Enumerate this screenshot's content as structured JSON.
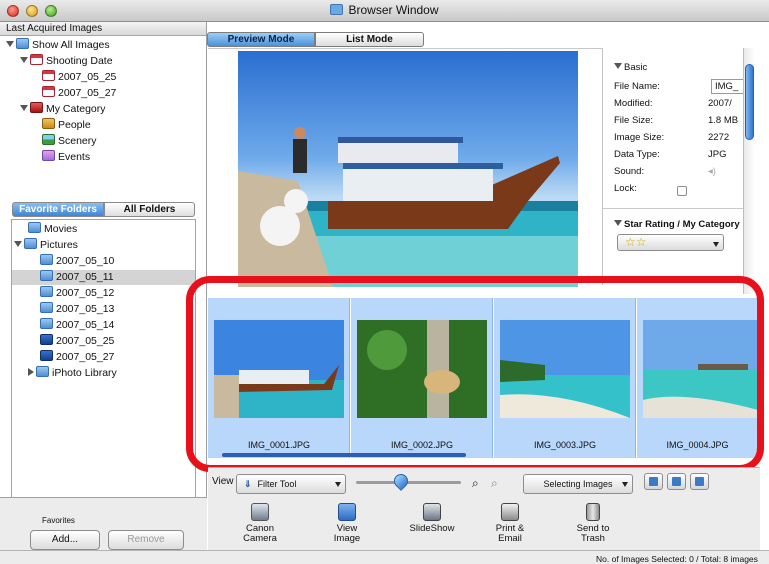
{
  "window": {
    "title": "Browser Window"
  },
  "sidebar": {
    "last_acquired_header": "Last Acquired Images",
    "tree": [
      {
        "label": "Show All Images",
        "icon": "all-images-icon"
      },
      {
        "label": "Shooting Date",
        "icon": "calendar-icon"
      },
      {
        "label": "2007_05_25",
        "icon": "calendar-date-icon"
      },
      {
        "label": "2007_05_27",
        "icon": "calendar-date-icon"
      },
      {
        "label": "My Category",
        "icon": "category-icon"
      },
      {
        "label": "People",
        "icon": "people-icon"
      },
      {
        "label": "Scenery",
        "icon": "scenery-icon"
      },
      {
        "label": "Events",
        "icon": "events-icon"
      }
    ],
    "tabs": [
      "Favorite Folders",
      "All Folders"
    ],
    "folders": [
      {
        "label": "Movies",
        "icon": "folder-icon"
      },
      {
        "label": "Pictures",
        "icon": "folder-icon"
      },
      {
        "label": "2007_05_10",
        "icon": "folder-icon"
      },
      {
        "label": "2007_05_11",
        "icon": "folder-icon",
        "selected": true
      },
      {
        "label": "2007_05_12",
        "icon": "folder-icon"
      },
      {
        "label": "2007_05_13",
        "icon": "folder-icon"
      },
      {
        "label": "2007_05_14",
        "icon": "folder-icon"
      },
      {
        "label": "2007_05_25",
        "icon": "download-folder-icon"
      },
      {
        "label": "2007_05_27",
        "icon": "download-folder-icon"
      },
      {
        "label": "iPhoto Library",
        "icon": "folder-icon"
      }
    ],
    "favorites_label": "Favorites",
    "add_button": "Add...",
    "remove_button": "Remove"
  },
  "view_modes": [
    "Preview Mode",
    "List Mode"
  ],
  "info": {
    "basic_header": "Basic",
    "fields": [
      {
        "label": "File Name:",
        "value": "IMG_"
      },
      {
        "label": "Modified:",
        "value": "2007/"
      },
      {
        "label": "File Size:",
        "value": "1.8 MB"
      },
      {
        "label": "Image Size:",
        "value": "2272"
      },
      {
        "label": "Data Type:",
        "value": "JPG"
      },
      {
        "label": "Sound:",
        "value": ""
      },
      {
        "label": "Lock:",
        "value": ""
      }
    ],
    "rating_header": "Star Rating / My Category",
    "rating_value": "☆☆"
  },
  "thumbnails": [
    {
      "filename": "IMG_0001.JPG"
    },
    {
      "filename": "IMG_0002.JPG"
    },
    {
      "filename": "IMG_0003.JPG"
    },
    {
      "filename": "IMG_0004.JPG"
    }
  ],
  "toolbar": {
    "view_label": "View",
    "filter_tool": "Filter Tool",
    "selecting_images": "Selecting Images"
  },
  "actions": [
    {
      "label": "Canon\nCamera",
      "icon": "camera-icon"
    },
    {
      "label": "View\nImage",
      "icon": "view-image-icon"
    },
    {
      "label": "SlideShow",
      "icon": "slideshow-icon"
    },
    {
      "label": "Print &\nEmail",
      "icon": "print-icon"
    },
    {
      "label": "Send to\nTrash",
      "icon": "trash-icon"
    }
  ],
  "status": {
    "text": "No. of Images Selected: 0 / Total: 8 images"
  },
  "colors": {
    "accent": "#4b92dc",
    "highlight": "#e8101a",
    "selection": "#b8d7fb"
  }
}
